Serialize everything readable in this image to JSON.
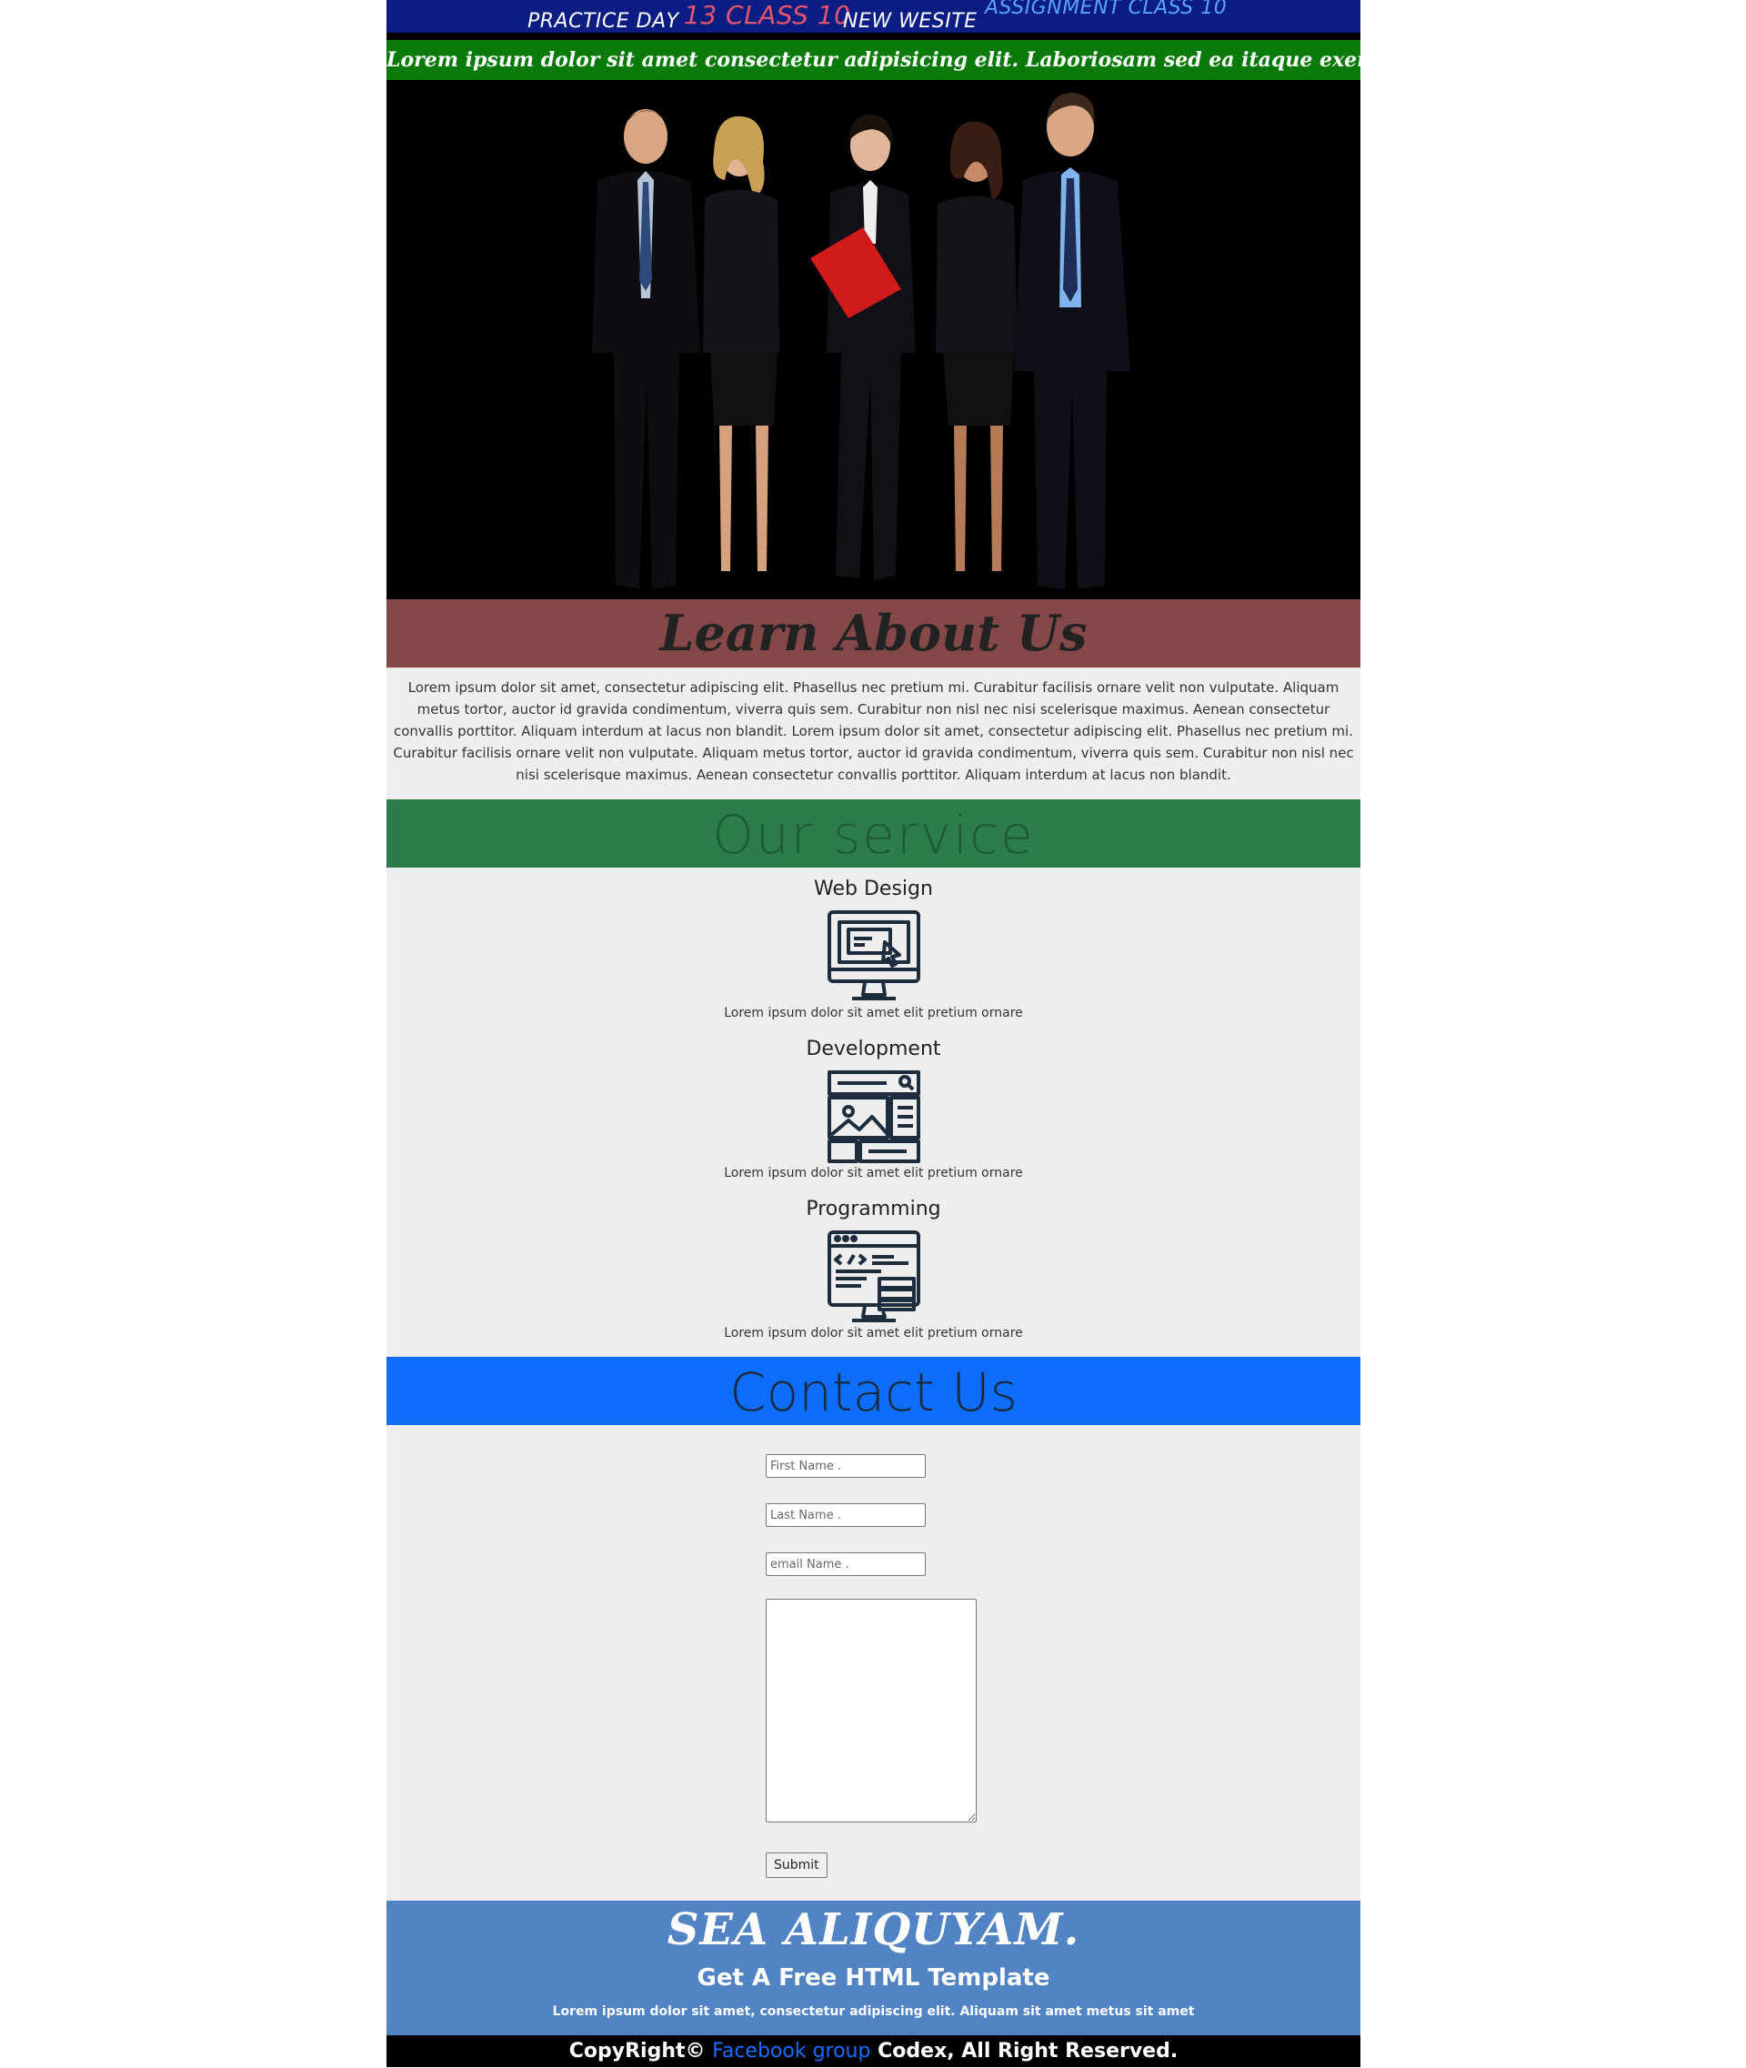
{
  "header": {
    "part1": "PRACTICE DAY",
    "part2": "13 CLASS 10",
    "part3": "NEW WESITE",
    "part4": "ASSIGNMENT CLASS 10",
    "tagline": "Lorem ipsum dolor sit amet consectetur adipisicing elit. Laboriosam sed ea itaque exercitationem ."
  },
  "hero": {
    "image_alt": "business-team-photo"
  },
  "about": {
    "title": "Learn About Us",
    "text": "Lorem ipsum dolor sit amet, consectetur adipiscing elit. Phasellus nec pretium mi. Curabitur facilisis ornare velit non vulputate. Aliquam metus tortor, auctor id gravida condimentum, viverra quis sem. Curabitur non nisl nec nisi scelerisque maximus. Aenean consectetur convallis porttitor. Aliquam interdum at lacus non blandit. Lorem ipsum dolor sit amet, consectetur adipiscing elit. Phasellus nec pretium mi. Curabitur facilisis ornare velit non vulputate. Aliquam metus tortor, auctor id gravida condimentum, viverra quis sem. Curabitur non nisl nec nisi scelerisque maximus. Aenean consectetur convallis porttitor. Aliquam interdum at lacus non blandit."
  },
  "services": {
    "title": "Our service",
    "items": [
      {
        "name": "Web Design",
        "icon": "monitor-web-design-icon",
        "desc": "Lorem ipsum dolor sit amet elit pretium ornare"
      },
      {
        "name": "Development",
        "icon": "layout-wireframe-icon",
        "desc": "Lorem ipsum dolor sit amet elit pretium ornare"
      },
      {
        "name": "Programming",
        "icon": "code-window-icon",
        "desc": "Lorem ipsum dolor sit amet elit pretium ornare"
      }
    ]
  },
  "contact": {
    "title": "Contact Us",
    "first_placeholder": "First Name .",
    "last_placeholder": "Last Name .",
    "email_placeholder": "email Name .",
    "submit_label": "Submit"
  },
  "footer": {
    "brand": "SEA ALIQUYAM.",
    "heading": "Get A Free HTML Template",
    "text": "Lorem ipsum dolor sit amet, consectetur adipiscing elit. Aliquam sit amet metus sit amet",
    "copy_prefix": "CopyRight©",
    "copy_link": "Facebook group",
    "copy_suffix": "Codex, All Right Reserved."
  },
  "colors": {
    "topbar": "#0b1d82",
    "tagline_bg": "#0a7a0a",
    "about_bg": "#854848",
    "service_bg": "#2d7c4c",
    "contact_bg": "#0d6efd",
    "footer_bg": "#5183c5"
  }
}
